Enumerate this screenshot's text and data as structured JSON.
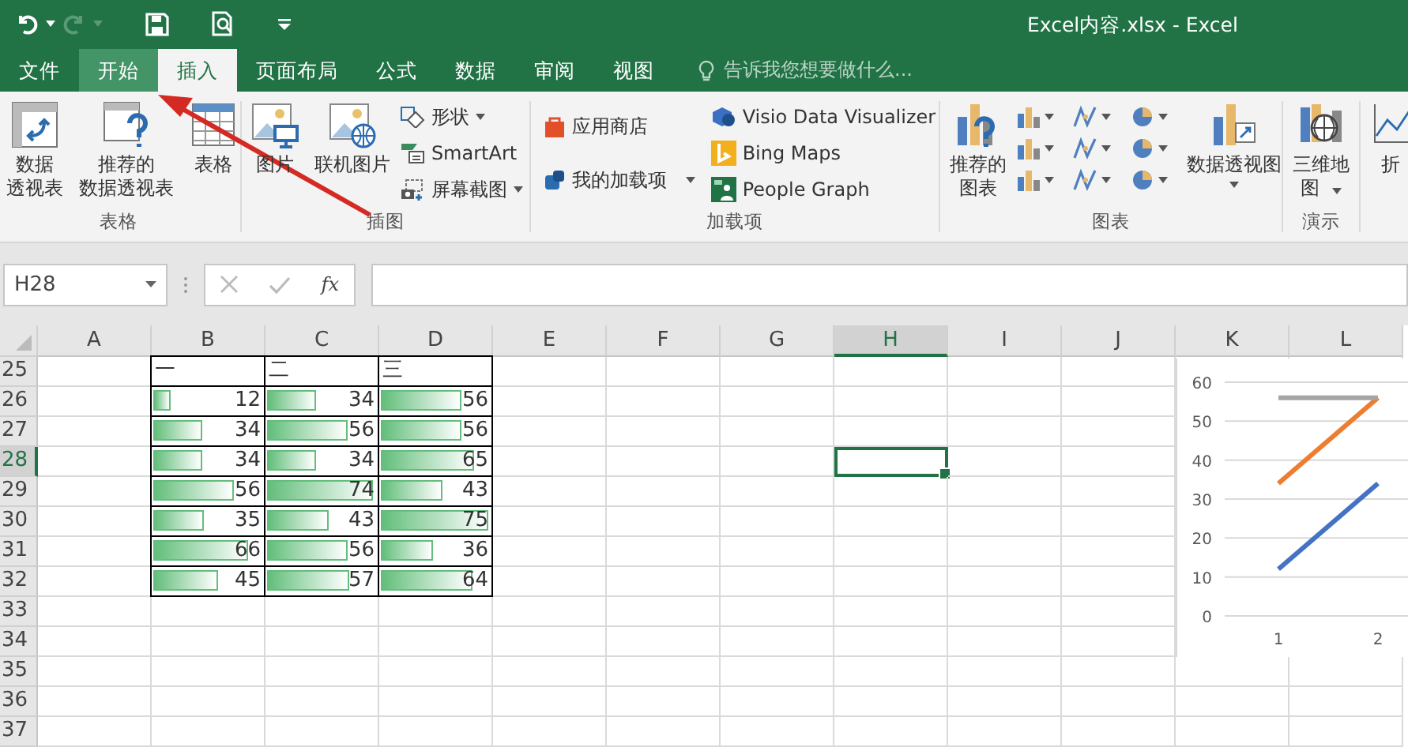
{
  "window": {
    "title": "Excel内容.xlsx - Excel"
  },
  "quick_access": {
    "redo_disabled": true
  },
  "tabs": [
    {
      "label": "文件",
      "selected": false,
      "hover": false
    },
    {
      "label": "开始",
      "selected": false,
      "hover": true
    },
    {
      "label": "插入",
      "selected": true,
      "hover": false
    },
    {
      "label": "页面布局",
      "selected": false,
      "hover": false
    },
    {
      "label": "公式",
      "selected": false,
      "hover": false
    },
    {
      "label": "数据",
      "selected": false,
      "hover": false
    },
    {
      "label": "审阅",
      "selected": false,
      "hover": false
    },
    {
      "label": "视图",
      "selected": false,
      "hover": false
    }
  ],
  "tell_me": {
    "placeholder": "告诉我您想要做什么..."
  },
  "ribbon": {
    "groups": [
      {
        "label": "表格",
        "items": [
          {
            "lines": [
              "数据",
              "透视表"
            ]
          },
          {
            "lines": [
              "推荐的",
              "数据透视表"
            ]
          },
          {
            "lines": [
              "表格"
            ]
          }
        ]
      },
      {
        "label": "插图",
        "items": [
          {
            "lines": [
              "图片"
            ]
          },
          {
            "lines": [
              "联机图片"
            ]
          },
          {
            "lines": [
              "形状"
            ]
          },
          {
            "lines": [
              "SmartArt"
            ]
          },
          {
            "lines": [
              "屏幕截图"
            ]
          }
        ]
      },
      {
        "label": "加载项",
        "items": [
          {
            "lines": [
              "应用商店"
            ]
          },
          {
            "lines": [
              "我的加载项"
            ]
          },
          {
            "lines": [
              "Visio Data Visualizer"
            ]
          },
          {
            "lines": [
              "Bing Maps"
            ]
          },
          {
            "lines": [
              "People Graph"
            ]
          }
        ]
      },
      {
        "label": "图表",
        "items": [
          {
            "lines": [
              "推荐的",
              "图表"
            ]
          },
          {
            "lines": [
              "数据透视图"
            ]
          }
        ]
      },
      {
        "label": "演示",
        "items": [
          {
            "lines": [
              "三维地",
              "图"
            ]
          }
        ]
      },
      {
        "items": [
          {
            "lines": [
              "折"
            ]
          }
        ]
      }
    ]
  },
  "formula_bar": {
    "name_box": "H28",
    "fx": "fx"
  },
  "sheet": {
    "columns": [
      {
        "label": "A",
        "selected": false
      },
      {
        "label": "B",
        "selected": false
      },
      {
        "label": "C",
        "selected": false
      },
      {
        "label": "D",
        "selected": false
      },
      {
        "label": "E",
        "selected": false
      },
      {
        "label": "F",
        "selected": false
      },
      {
        "label": "G",
        "selected": false
      },
      {
        "label": "H",
        "selected": true
      },
      {
        "label": "I",
        "selected": false
      },
      {
        "label": "J",
        "selected": false
      },
      {
        "label": "K",
        "selected": false
      },
      {
        "label": "L",
        "selected": false
      }
    ],
    "rows": [
      {
        "label": "25",
        "selected": false
      },
      {
        "label": "26",
        "selected": false
      },
      {
        "label": "27",
        "selected": false
      },
      {
        "label": "28",
        "selected": true
      },
      {
        "label": "29",
        "selected": false
      },
      {
        "label": "30",
        "selected": false
      },
      {
        "label": "31",
        "selected": false
      },
      {
        "label": "32",
        "selected": false
      },
      {
        "label": "33",
        "selected": false
      },
      {
        "label": "34",
        "selected": false
      },
      {
        "label": "35",
        "selected": false
      },
      {
        "label": "36",
        "selected": false
      },
      {
        "label": "37",
        "selected": false
      }
    ]
  },
  "table": {
    "header": [
      "一",
      "二",
      "三"
    ],
    "rows": [
      [
        {
          "value": "12",
          "level": 0.16
        },
        {
          "value": "34",
          "level": 0.45
        },
        {
          "value": "56",
          "level": 0.75
        }
      ],
      [
        {
          "value": "34",
          "level": 0.45
        },
        {
          "value": "56",
          "level": 0.75
        },
        {
          "value": "56",
          "level": 0.75
        }
      ],
      [
        {
          "value": "34",
          "level": 0.45
        },
        {
          "value": "34",
          "level": 0.45
        },
        {
          "value": "65",
          "level": 0.87
        }
      ],
      [
        {
          "value": "56",
          "level": 0.75
        },
        {
          "value": "74",
          "level": 0.99
        },
        {
          "value": "43",
          "level": 0.57
        }
      ],
      [
        {
          "value": "35",
          "level": 0.47
        },
        {
          "value": "43",
          "level": 0.57
        },
        {
          "value": "75",
          "level": 1
        }
      ],
      [
        {
          "value": "66",
          "level": 0.88
        },
        {
          "value": "56",
          "level": 0.75
        },
        {
          "value": "36",
          "level": 0.48
        }
      ],
      [
        {
          "value": "45",
          "level": 0.6
        },
        {
          "value": "57",
          "level": 0.76
        },
        {
          "value": "64",
          "level": 0.85
        }
      ]
    ]
  },
  "chart": {
    "chart_data": {
      "type": "line",
      "grid": true,
      "categories": [
        "1",
        "2"
      ],
      "ylim": [
        0,
        60
      ],
      "yticks": [
        0,
        10,
        20,
        30,
        40,
        50,
        60
      ],
      "series": [
        {
          "color": "#4472c4",
          "values": [
            12,
            34
          ]
        },
        {
          "color": "#ed7d31",
          "values": [
            34,
            56
          ]
        },
        {
          "color": "#a5a5a5",
          "values": [
            56,
            56
          ]
        }
      ]
    }
  }
}
